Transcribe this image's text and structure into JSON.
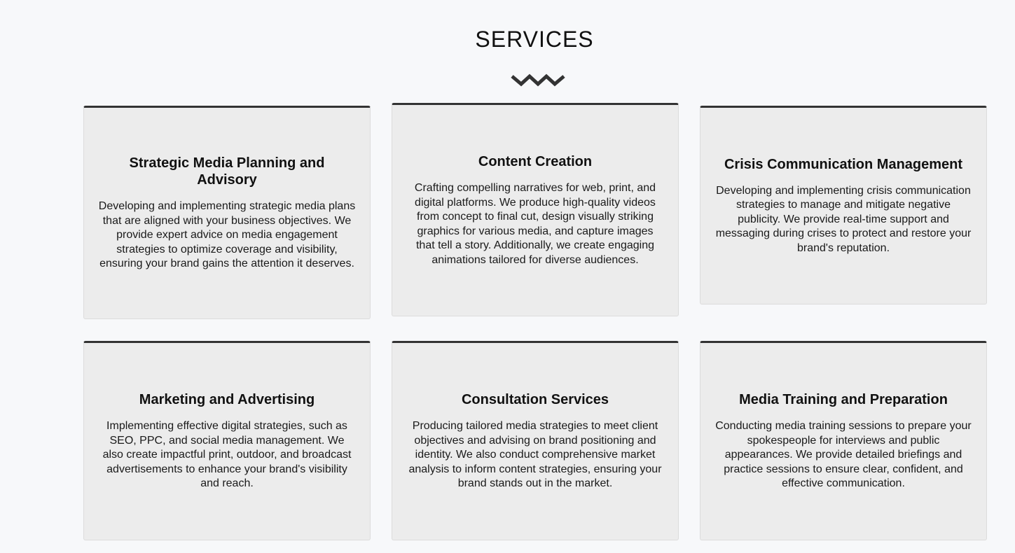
{
  "section": {
    "title": "SERVICES",
    "divider_icon": "zigzag-divider-icon"
  },
  "services": [
    {
      "title": "Strategic Media Planning and Advisory",
      "description": "Developing and implementing strategic media plans that are aligned with your business objectives. We provide expert advice on media engagement strategies to optimize coverage and visibility, ensuring your brand gains the attention it deserves."
    },
    {
      "title": "Content Creation",
      "description": "Crafting compelling narratives for web, print, and digital platforms. We produce high-quality videos from concept to final cut, design visually striking graphics for various media, and capture images that tell a story. Additionally, we create engaging animations tailored for diverse audiences."
    },
    {
      "title": "Crisis Communication Management",
      "description": "Developing and implementing crisis communication strategies to manage and mitigate negative publicity. We provide real-time support and messaging during crises to protect and restore your brand's reputation."
    },
    {
      "title": "Marketing and Advertising",
      "description": "Implementing effective digital strategies, such as SEO, PPC, and social media management. We also create impactful print, outdoor, and broadcast advertisements to enhance your brand's visibility and reach."
    },
    {
      "title": "Consultation Services",
      "description": "Producing tailored media strategies to meet client objectives and advising on brand positioning and identity. We also conduct comprehensive market analysis to inform content strategies, ensuring your brand stands out in the market."
    },
    {
      "title": "Media Training and Preparation",
      "description": "Conducting media training sessions to prepare your spokespeople for interviews and public appearances. We provide detailed briefings and practice sessions to ensure clear, confident, and effective communication."
    }
  ],
  "colors": {
    "page_background": "#f7f8fa",
    "card_background": "#ececec",
    "card_top_border": "#333333",
    "text": "#111111"
  }
}
